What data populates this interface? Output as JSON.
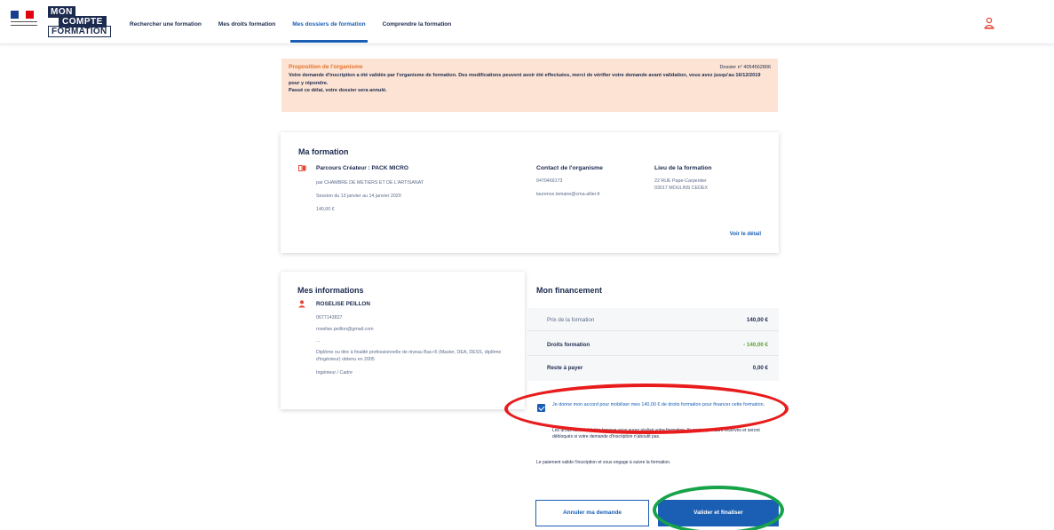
{
  "header": {
    "brand": {
      "line1": "MON",
      "line2": "COMPTE",
      "line3": "FORMATION"
    },
    "nav": [
      {
        "label": "Rechercher une formation",
        "active": false
      },
      {
        "label": "Mes droits formation",
        "active": false
      },
      {
        "label": "Mes dossiers de formation",
        "active": true
      },
      {
        "label": "Comprendre la formation",
        "active": false
      }
    ],
    "user_icon": "user-icon"
  },
  "alert": {
    "title": "Proposition de l'organisme",
    "dossier": "Dossier n° 4054562806",
    "text1": "Votre demande d'inscription a été validée par l'organisme de formation. Des modifications peuvent avoir été effectuées, merci de vérifier votre demande avant validation, vous avez jusqu'au 16/12/2019 pour y répondre.",
    "text2": "Passé ce délai, votre dossier sera annulé."
  },
  "formation": {
    "title": "Ma formation",
    "name": "Parcours Créateur : PACK MICRO",
    "organisme": "par CHAMBRE DE METIERS ET DE L'ARTISANAT",
    "session": "Session du 13 janvier au 14 janvier 2020",
    "price": "140,00 €",
    "contact_title": "Contact de l'organisme",
    "contact_phone": "0470469173",
    "contact_email": "laurence.lemaire@cma-allier.fr",
    "lieu_title": "Lieu de la formation",
    "lieu_line1": "22 RUE Pape-Carpentier",
    "lieu_line2": "03017 MOULINS CEDEX",
    "detail_link": "Voir le détail"
  },
  "informations": {
    "title": "Mes informations",
    "name": "ROSELISE PEILLON",
    "phone": "0677143827",
    "email": "roselise.peillon@gmail.com",
    "ellipsis": "...",
    "diploma": "Diplôme ou titre à finalité professionnelle de niveau Bac+5 (Master, DEA, DESS, diplôme d'ingénieur) obtenu en 2005",
    "status": "Ingénieur / Cadre"
  },
  "financement": {
    "title": "Mon financement",
    "rows": [
      {
        "label": "Prix de la formation",
        "value": "140,00 €"
      },
      {
        "label": "Droits formation",
        "value": "- 140,00 €"
      },
      {
        "label": "Reste à payer",
        "value": "0,00 €"
      }
    ],
    "consent": "Je donne mon accord pour mobiliser mes 140,00 € de droits formation pour financer cette formation.",
    "consent_checked": true,
    "note1": "Les droits seront débités lorsque vous aurez réalisé votre formation. Ils sont cependant réservés et seront débloqués si votre demande d'inscription n'aboutit pas.",
    "note2": "Le paiement valide l'inscription et vous engage à suivre la formation.",
    "cancel_label": "Annuler ma demande",
    "validate_label": "Valider et finaliser"
  },
  "colors": {
    "primary": "#1a5fb4",
    "navy": "#1b2a4e",
    "alert_bg": "#fde3d3",
    "alert_title": "#e0732c",
    "annotation_red": "#e81c1c",
    "annotation_green": "#17a34a"
  }
}
